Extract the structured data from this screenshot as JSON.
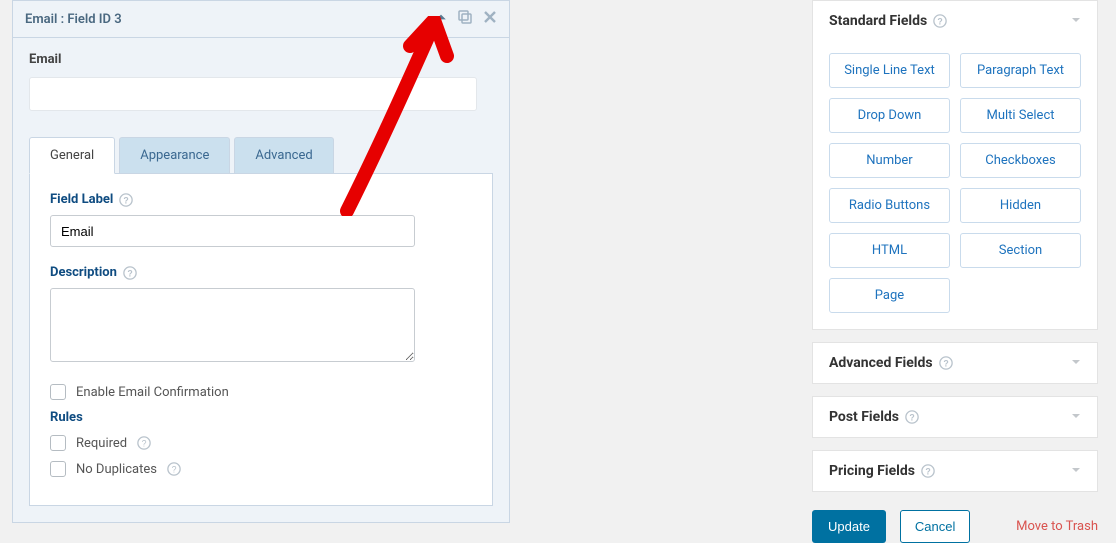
{
  "panel": {
    "header_title": "Email : Field ID 3",
    "preview_label": "Email",
    "preview_value": ""
  },
  "tabs": {
    "general": "General",
    "appearance": "Appearance",
    "advanced": "Advanced"
  },
  "settings": {
    "field_label_title": "Field Label",
    "field_label_value": "Email",
    "description_title": "Description",
    "description_value": "",
    "enable_confirmation_label": "Enable Email Confirmation",
    "rules_title": "Rules",
    "required_label": "Required",
    "no_duplicates_label": "No Duplicates"
  },
  "sidebar": {
    "standard_fields_title": "Standard Fields",
    "advanced_fields_title": "Advanced Fields",
    "post_fields_title": "Post Fields",
    "pricing_fields_title": "Pricing Fields",
    "standard_items": [
      "Single Line Text",
      "Paragraph Text",
      "Drop Down",
      "Multi Select",
      "Number",
      "Checkboxes",
      "Radio Buttons",
      "Hidden",
      "HTML",
      "Section",
      "Page"
    ]
  },
  "actions": {
    "update": "Update",
    "cancel": "Cancel",
    "trash": "Move to Trash"
  }
}
